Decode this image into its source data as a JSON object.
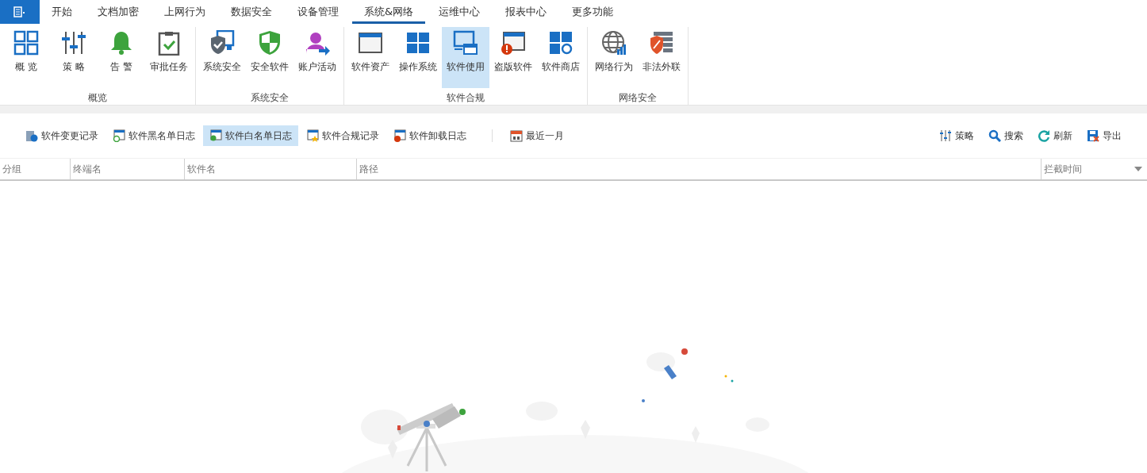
{
  "menu_tabs": [
    {
      "label": "开始",
      "selected": false
    },
    {
      "label": "文档加密",
      "selected": false
    },
    {
      "label": "上网行为",
      "selected": false
    },
    {
      "label": "数据安全",
      "selected": false
    },
    {
      "label": "设备管理",
      "selected": false
    },
    {
      "label": "系统&网络",
      "selected": true
    },
    {
      "label": "运维中心",
      "selected": false
    },
    {
      "label": "报表中心",
      "selected": false
    },
    {
      "label": "更多功能",
      "selected": false
    }
  ],
  "ribbon_groups": [
    {
      "label": "概览",
      "items": [
        {
          "label": "概 览",
          "selected": false
        },
        {
          "label": "策 略",
          "selected": false
        },
        {
          "label": "告 警",
          "selected": false
        },
        {
          "label": "审批任务",
          "selected": false
        }
      ]
    },
    {
      "label": "系统安全",
      "items": [
        {
          "label": "系统安全",
          "selected": false
        },
        {
          "label": "安全软件",
          "selected": false
        },
        {
          "label": "账户活动",
          "selected": false
        }
      ]
    },
    {
      "label": "软件合规",
      "items": [
        {
          "label": "软件资产",
          "selected": false
        },
        {
          "label": "操作系统",
          "selected": false
        },
        {
          "label": "软件使用",
          "selected": true
        },
        {
          "label": "盗版软件",
          "selected": false
        },
        {
          "label": "软件商店",
          "selected": false
        }
      ]
    },
    {
      "label": "网络安全",
      "items": [
        {
          "label": "网络行为",
          "selected": false
        },
        {
          "label": "非法外联",
          "selected": false
        }
      ]
    }
  ],
  "toolbar": {
    "views": [
      {
        "label": "软件变更记录",
        "selected": false
      },
      {
        "label": "软件黑名单日志",
        "selected": false
      },
      {
        "label": "软件白名单日志",
        "selected": true
      },
      {
        "label": "软件合规记录",
        "selected": false
      },
      {
        "label": "软件卸载日志",
        "selected": false
      }
    ],
    "date_range": "最近一月",
    "actions": [
      "策略",
      "搜索",
      "刷新",
      "导出"
    ]
  },
  "table": {
    "columns": [
      "分组",
      "终端名",
      "软件名",
      "路径",
      "拦截时间"
    ]
  }
}
